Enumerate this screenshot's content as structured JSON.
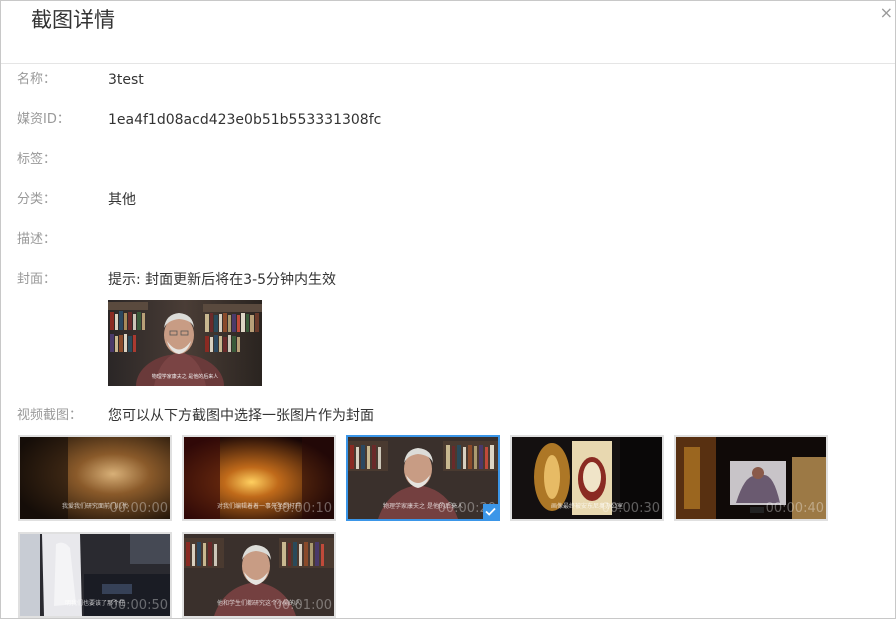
{
  "dialog": {
    "title": "截图详情",
    "close_glyph": "×"
  },
  "fields": {
    "name": {
      "label": "名称：",
      "value": "3test"
    },
    "media_id": {
      "label": "媒资ID：",
      "value": "1ea4f1d08acd423e0b51b553331308fc"
    },
    "tags": {
      "label": "标签：",
      "value": ""
    },
    "category": {
      "label": "分类：",
      "value": "其他"
    },
    "description": {
      "label": "描述：",
      "value": ""
    },
    "cover": {
      "label": "封面：",
      "hint": "提示: 封面更新后将在3-5分钟内生效"
    },
    "screenshots": {
      "label": "视频截图：",
      "hint": "您可以从下方截图中选择一张图片作为封面"
    }
  },
  "thumbnails": [
    {
      "time": "00:00:00",
      "subtitle": "我爱我们研究面前门儿代",
      "scene": "dark-amber",
      "selected": false
    },
    {
      "time": "00:00:10",
      "subtitle": "对我们编辑着着一事先坐到打开",
      "scene": "glass-amber",
      "selected": false
    },
    {
      "time": "00:00:20",
      "subtitle": "物理学家康夫之 是他的后来人",
      "scene": "interview",
      "selected": true
    },
    {
      "time": "00:00:30",
      "subtitle": "画像最终被安东尼奥办公室",
      "scene": "painting",
      "selected": false
    },
    {
      "time": "00:00:40",
      "subtitle": "",
      "scene": "crowd",
      "selected": false
    },
    {
      "time": "00:00:50",
      "subtitle": "明我们也要该了那个任",
      "scene": "statue",
      "selected": false
    },
    {
      "time": "00:01:00",
      "subtitle": "他和学生们都研究这个小偷的人",
      "scene": "interview",
      "selected": false
    }
  ],
  "cover_subtitle": "物理学家康夫之 是他的后来人",
  "icons": {
    "close": "close-icon",
    "check": "check-icon"
  },
  "colors": {
    "accent": "#3b96e8",
    "label": "#999999",
    "text": "#333333"
  }
}
